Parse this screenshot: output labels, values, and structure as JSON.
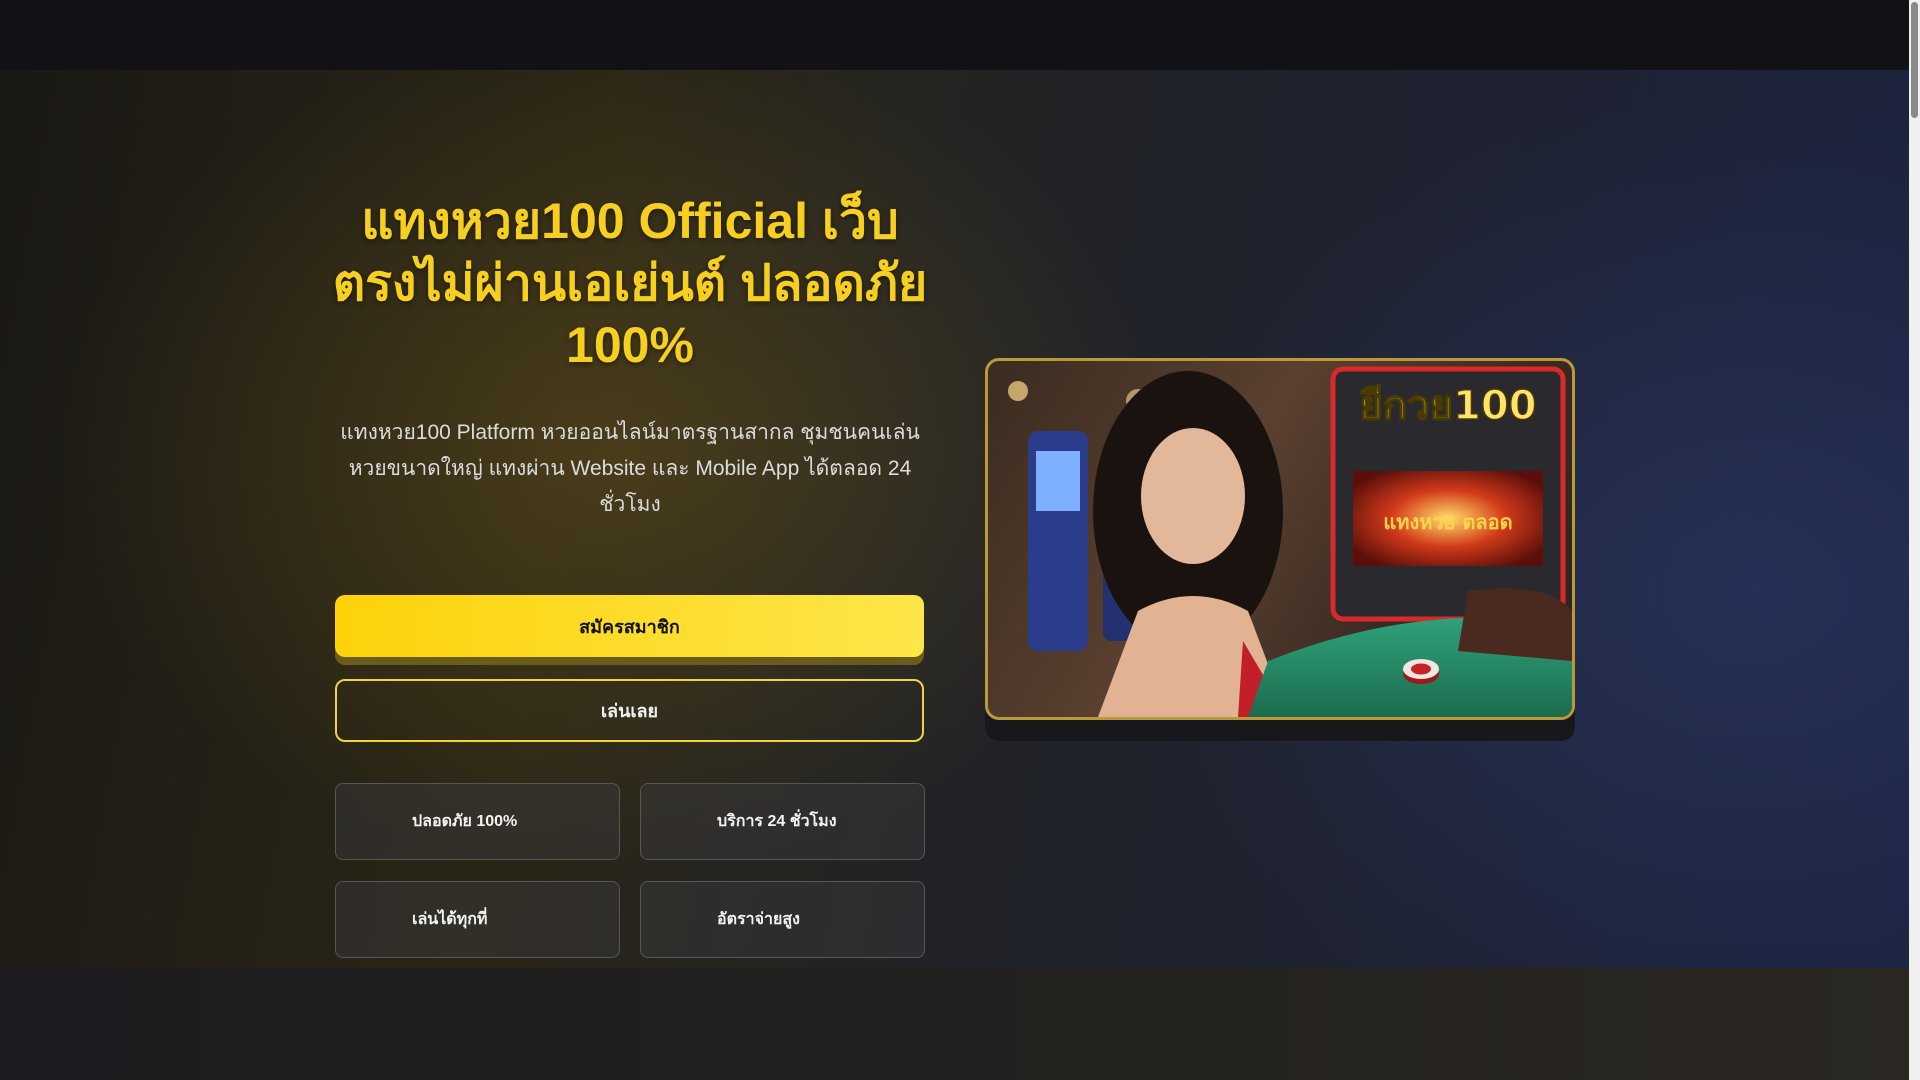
{
  "hero": {
    "title": "แทงหวย100 Official เว็บตรงไม่ผ่านเอเย่นต์ ปลอดภัย 100%",
    "description": "แทงหวย100 Platform หวยออนไลน์มาตรฐานสากล ชุมชนคนเล่นหวยขนาดใหญ่ แทงผ่าน Website และ Mobile App ได้ตลอด 24 ชั่วโมง",
    "register_label": "สมัครสมาชิก",
    "play_label": "เล่นเลย",
    "features": [
      {
        "label": "ปลอดภัย 100%"
      },
      {
        "label": "บริการ 24 ชั่วโมง"
      },
      {
        "label": "เล่นได้ทุกที่"
      },
      {
        "label": "อัตราจ่ายสูง"
      }
    ]
  },
  "colors": {
    "accent": "#f7cf1e",
    "button_yellow": "#fdd20a",
    "frame_gold": "#b99a3a"
  },
  "media": {
    "sign_text": "ยีกวย100",
    "screen_text": "แทงหวย ตลอด"
  }
}
